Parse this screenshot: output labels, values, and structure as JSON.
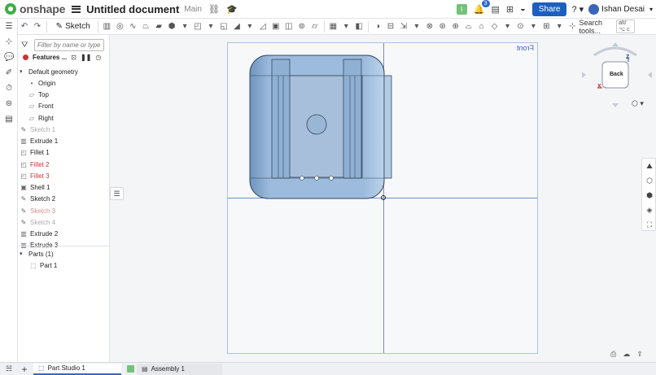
{
  "header": {
    "app_name": "onshape",
    "doc_title": "Untitled document",
    "branch": "Main",
    "notification_count": "3",
    "share_label": "Share",
    "user_name": "Ishan Desai",
    "badge_letter": "I"
  },
  "toolbar": {
    "sketch_label": "Sketch",
    "search_label": "Search tools...",
    "search_shortcut": "alt/⌥ c"
  },
  "panel": {
    "filter_placeholder": "Filter by name or type",
    "features_label": "Features ...",
    "tree": [
      {
        "label": "Default geometry",
        "state": "normal",
        "kind": "group"
      },
      {
        "label": "Origin",
        "state": "normal",
        "kind": "origin"
      },
      {
        "label": "Top",
        "state": "normal",
        "kind": "plane"
      },
      {
        "label": "Front",
        "state": "normal",
        "kind": "plane"
      },
      {
        "label": "Right",
        "state": "normal",
        "kind": "plane"
      },
      {
        "label": "Sketch 1",
        "state": "hidden",
        "kind": "sketch"
      },
      {
        "label": "Extrude 1",
        "state": "normal",
        "kind": "extrude"
      },
      {
        "label": "Fillet 1",
        "state": "normal",
        "kind": "fillet"
      },
      {
        "label": "Fillet 2",
        "state": "error",
        "kind": "fillet"
      },
      {
        "label": "Fillet 3",
        "state": "error",
        "kind": "fillet"
      },
      {
        "label": "Shell 1",
        "state": "normal",
        "kind": "shell"
      },
      {
        "label": "Sketch 2",
        "state": "normal",
        "kind": "sketch"
      },
      {
        "label": "Sketch 3",
        "state": "hidden-error",
        "kind": "sketch"
      },
      {
        "label": "Sketch 4",
        "state": "hidden",
        "kind": "sketch"
      },
      {
        "label": "Extrude 2",
        "state": "normal",
        "kind": "extrude"
      },
      {
        "label": "Extrude 3",
        "state": "normal",
        "kind": "extrude"
      }
    ],
    "parts_label": "Parts (1)",
    "part_item": "Part 1"
  },
  "viewport": {
    "view_label": "Front",
    "cube_face": "Back",
    "axis_x": "X",
    "axis_z": "Z"
  },
  "tabs": [
    {
      "label": "Part Studio 1",
      "active": true
    },
    {
      "label": "Assembly 1",
      "active": false
    }
  ],
  "colors": {
    "brand_green": "#3fae47",
    "share_blue": "#1d5fbf",
    "part_blue": "#8fb2d6",
    "error_red": "#c23a3a"
  }
}
